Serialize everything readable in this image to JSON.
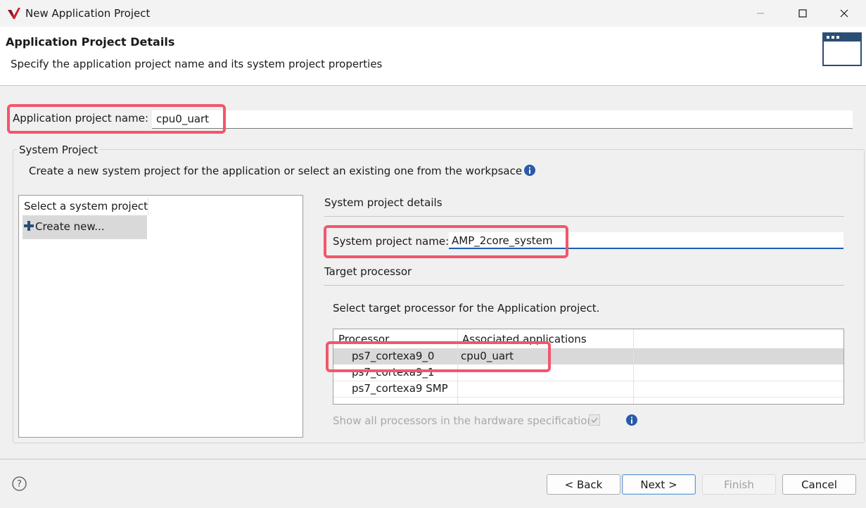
{
  "window": {
    "title": "New Application Project"
  },
  "header": {
    "title": "Application Project Details",
    "subtitle": "Specify the application project name and its system project properties"
  },
  "app_project": {
    "label": "Application project name:",
    "value": "cpu0_uart"
  },
  "system_project": {
    "legend": "System Project",
    "description": "Create a new system project for the application or select an existing one from the workpsace",
    "list": {
      "header": "Select a system project",
      "items": [
        {
          "label": "Create new..."
        }
      ]
    },
    "details_title": "System project details",
    "name_label": "System project name:",
    "name_value": "AMP_2core_system",
    "target_title": "Target processor",
    "target_desc": "Select target processor for the Application project.",
    "table": {
      "columns": [
        "Processor",
        "Associated applications"
      ],
      "rows": [
        {
          "processor": "ps7_cortexa9_0",
          "apps": "cpu0_uart",
          "selected": true
        },
        {
          "processor": "ps7_cortexa9_1",
          "apps": ""
        },
        {
          "processor": "ps7_cortexa9 SMP",
          "apps": ""
        }
      ]
    },
    "show_all_label": "Show all processors in the hardware specification",
    "show_all_checked": true
  },
  "buttons": {
    "back": "< Back",
    "next": "Next >",
    "finish": "Finish",
    "cancel": "Cancel"
  },
  "colors": {
    "highlight": "#f2566b",
    "accent": "#1a5fb4",
    "info": "#2a5aa8"
  }
}
